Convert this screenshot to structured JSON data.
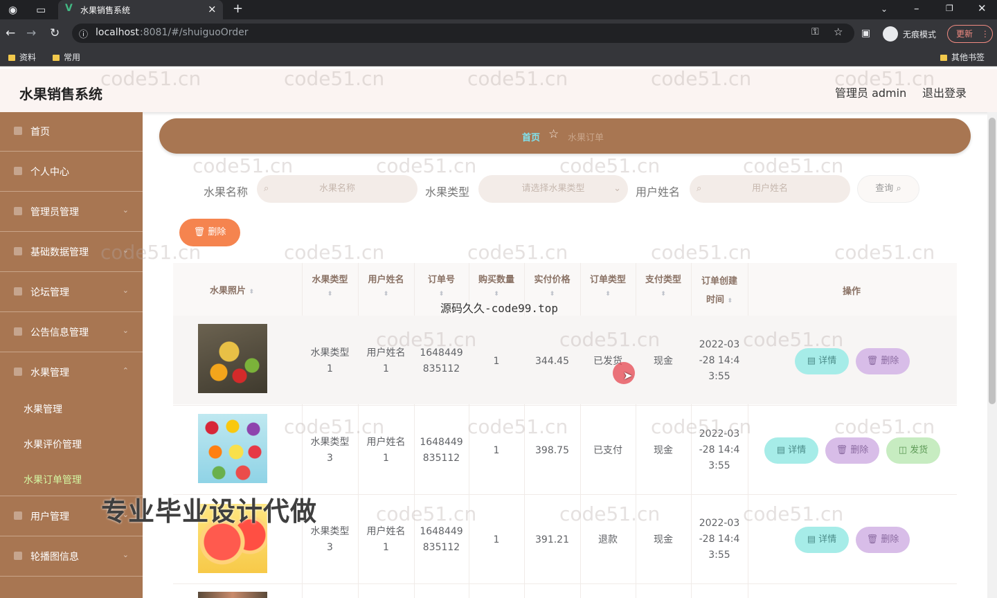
{
  "browser": {
    "tab_title": "水果销售系统",
    "tab_close": "×",
    "new_tab": "+",
    "url_host": "localhost",
    "url_rest": ":8081/#/shuiguoOrder",
    "incognito_label": "无痕模式",
    "update_label": "更新",
    "bookmarks": [
      "资料",
      "常用"
    ],
    "other_bookmarks": "其他书签"
  },
  "header": {
    "title": "水果销售系统",
    "admin": "管理员 admin",
    "logout": "退出登录"
  },
  "sidebar": {
    "items": [
      {
        "label": "首页"
      },
      {
        "label": "个人中心"
      },
      {
        "label": "管理员管理"
      },
      {
        "label": "基础数据管理"
      },
      {
        "label": "论坛管理"
      },
      {
        "label": "公告信息管理"
      },
      {
        "label": "水果管理"
      }
    ],
    "subitems": [
      "水果管理",
      "水果评价管理",
      "水果订单管理"
    ],
    "bottom_items": [
      {
        "label": "用户管理"
      },
      {
        "label": "轮播图信息"
      }
    ]
  },
  "breadcrumb": {
    "home": "首页",
    "current": "水果订单"
  },
  "filters": {
    "name_label": "水果名称",
    "name_placeholder": "水果名称",
    "type_label": "水果类型",
    "type_placeholder": "请选择水果类型",
    "user_label": "用户姓名",
    "user_placeholder": "用户姓名",
    "query": "查询"
  },
  "delete_button": "删除",
  "table": {
    "headers": {
      "photo": "水果照片",
      "type": "水果类型",
      "user": "用户姓名",
      "order_no": "订单号",
      "qty": "购买数量",
      "price": "实付价格",
      "order_type": "订单类型",
      "pay_type": "支付类型",
      "created_1": "订单创建",
      "created_2": "时间",
      "ops": "操作"
    },
    "rows": [
      {
        "type_1": "水果类型",
        "type_2": "1",
        "user_1": "用户姓名",
        "user_2": "1",
        "no_1": "1648449",
        "no_2": "835112",
        "qty": "1",
        "price": "344.45",
        "order_type": "已发货",
        "pay": "现金",
        "t1": "2022-03",
        "t2": "-28 14:4",
        "t3": "3:55"
      },
      {
        "type_1": "水果类型",
        "type_2": "3",
        "user_1": "用户姓名",
        "user_2": "1",
        "no_1": "1648449",
        "no_2": "835112",
        "qty": "1",
        "price": "398.75",
        "order_type": "已支付",
        "pay": "现金",
        "t1": "2022-03",
        "t2": "-28 14:4",
        "t3": "3:55"
      },
      {
        "type_1": "水果类型",
        "type_2": "3",
        "user_1": "用户姓名",
        "user_2": "1",
        "no_1": "1648449",
        "no_2": "835112",
        "qty": "1",
        "price": "391.21",
        "order_type": "退款",
        "pay": "现金",
        "t1": "2022-03",
        "t2": "-28 14:4",
        "t3": "3:55"
      }
    ],
    "detail": "详情",
    "delete": "删除",
    "ship": "发货"
  },
  "overlays": {
    "watermark": "code51.cn",
    "source": "源码久久-code99.top",
    "promo": "专业毕业设计代做"
  },
  "colors": {
    "primary": "#a87652",
    "header_bg": "#fbf4f2",
    "active_sub": "#d4f7a3"
  }
}
